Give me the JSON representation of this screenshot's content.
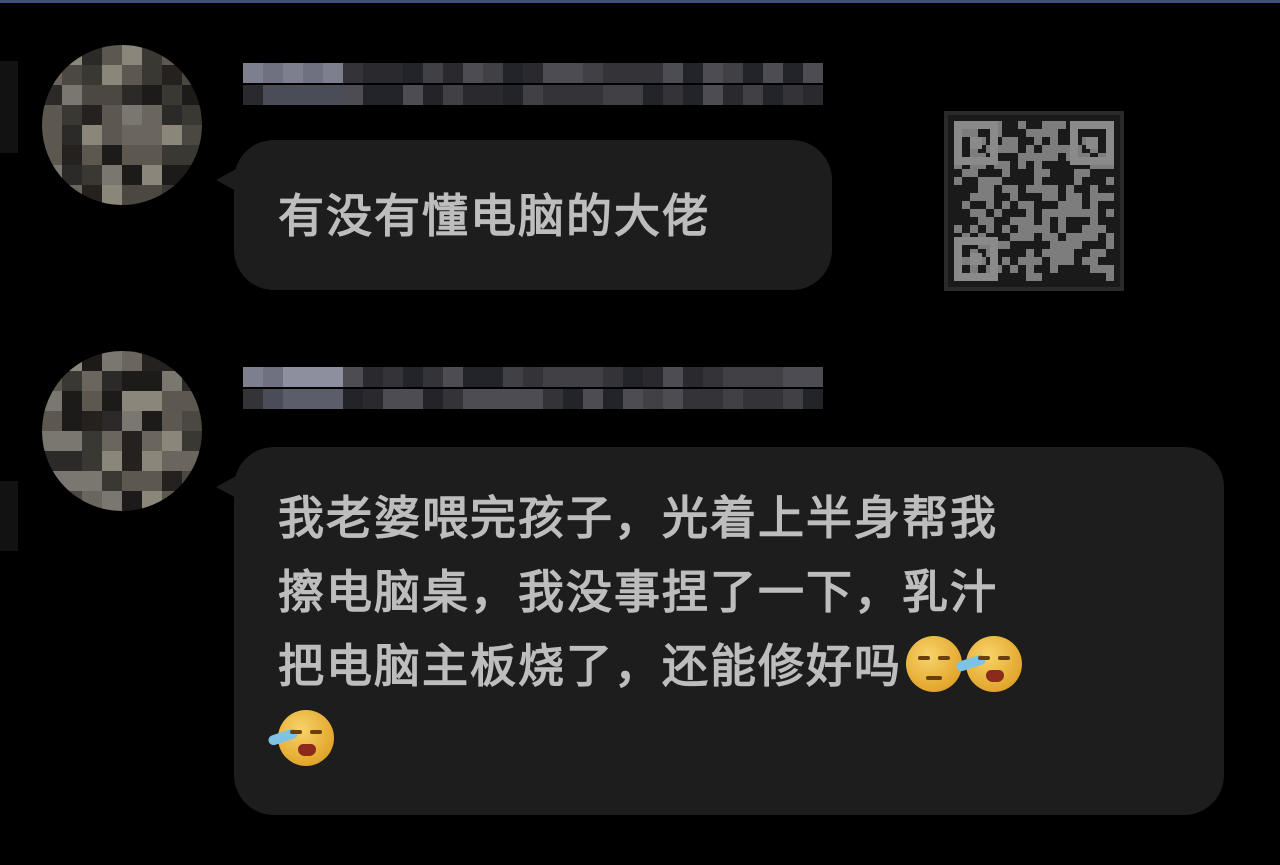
{
  "messages": [
    {
      "sender_blurred": true,
      "text": "有没有懂电脑的大佬"
    },
    {
      "sender_blurred": true,
      "lines": [
        "我老婆喂完孩子，光着上半身帮我",
        "擦电脑桌，我没事捏了一下，乳汁",
        "把电脑主板烧了，还能修好吗"
      ],
      "trailing_emojis": [
        "smirk-face-icon",
        "crying-face-icon",
        "crying-face-icon"
      ]
    }
  ],
  "qr_code": {
    "blurred": true
  },
  "colors": {
    "background": "#000000",
    "bubble": "#1d1d1d",
    "text": "#bdbdbd",
    "top_border": "#3d4f7a"
  }
}
